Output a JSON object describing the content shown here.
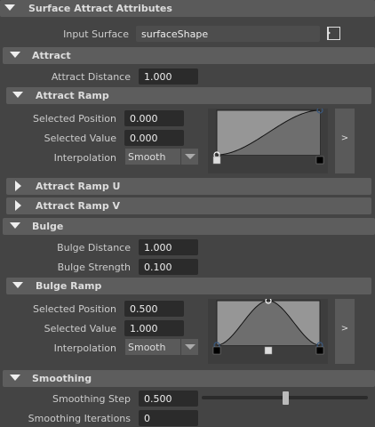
{
  "sections": {
    "main": "Surface Attract Attributes",
    "attract": "Attract",
    "attract_ramp": "Attract Ramp",
    "attract_ramp_u": "Attract Ramp U",
    "attract_ramp_v": "Attract Ramp V",
    "bulge": "Bulge",
    "bulge_ramp": "Bulge Ramp",
    "smoothing": "Smoothing"
  },
  "input_surface": {
    "label": "Input Surface",
    "value": "surfaceShape",
    "icon": "input-connection-icon"
  },
  "attract": {
    "distance_label": "Attract Distance",
    "distance": "1.000"
  },
  "attract_ramp": {
    "pos_label": "Selected Position",
    "pos": "0.000",
    "val_label": "Selected Value",
    "val": "0.000",
    "interp_label": "Interpolation",
    "interp": "Smooth",
    "expand": ">",
    "points": [
      [
        0,
        0
      ],
      [
        1,
        1
      ]
    ],
    "selected": 0
  },
  "bulge": {
    "distance_label": "Bulge Distance",
    "distance": "1.000",
    "strength_label": "Bulge Strength",
    "strength": "0.100"
  },
  "bulge_ramp": {
    "pos_label": "Selected Position",
    "pos": "0.500",
    "val_label": "Selected Value",
    "val": "1.000",
    "interp_label": "Interpolation",
    "interp": "Smooth",
    "expand": ">",
    "points": [
      [
        0,
        0
      ],
      [
        0.5,
        1
      ],
      [
        1,
        0
      ]
    ],
    "selected": 1
  },
  "smoothing": {
    "step_label": "Smoothing Step",
    "step": "0.500",
    "step_slider": 0.5,
    "iter_label": "Smoothing Iterations",
    "iter": "0"
  }
}
